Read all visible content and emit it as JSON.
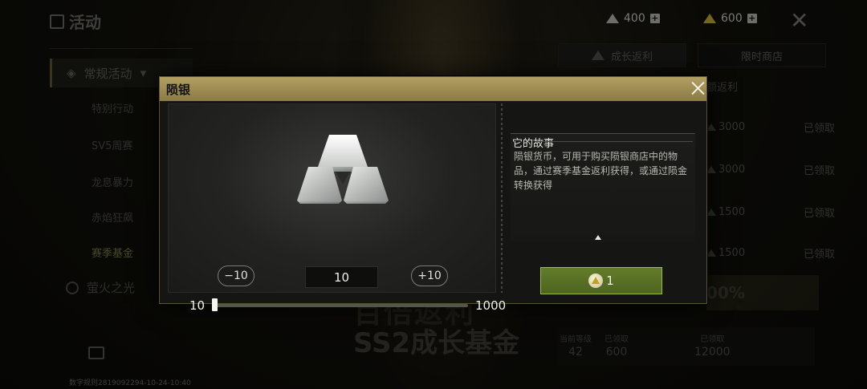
{
  "background": {
    "title": "活动",
    "resources": [
      {
        "icon": "silver-ingot-icon",
        "value": "400"
      },
      {
        "icon": "gold-ingot-icon",
        "value": "600"
      }
    ],
    "sidebar": {
      "section": "常规活动",
      "items": [
        "特别行动",
        "SV5周赛",
        "龙息暴力",
        "赤焰狂飙",
        "赛季基金"
      ],
      "active_index": 4,
      "footer": "萤火之光"
    },
    "tabs": [
      "成长返利",
      "限时商店"
    ],
    "rewards_header": "额返利",
    "rewards": [
      {
        "amount": "3000",
        "status": "已领取"
      },
      {
        "amount": "3000",
        "status": "已领取"
      },
      {
        "amount": "1500",
        "status": "已领取"
      },
      {
        "amount": "1500",
        "status": "已领取"
      }
    ],
    "percent": "00%",
    "banner_line1": "百倍返利",
    "banner_line2": "SS2成长基金",
    "stats": [
      {
        "label": "当前等级",
        "value": "42"
      },
      {
        "label": "已领取",
        "value": "600"
      },
      {
        "label": "已领取",
        "value": "12000"
      }
    ],
    "watermark": "数字规则2819092294-10-24-10:40"
  },
  "modal": {
    "title": "陨银",
    "item_icon": "silver-ingot-stack",
    "minus_label": "−10",
    "plus_label": "+10",
    "quantity": "10",
    "slider": {
      "min": "10",
      "max": "1000",
      "value_fraction": 0.0
    },
    "story_heading": "它的故事",
    "story_text": "陨银货币，可用于购买陨银商店中的物品，通过赛季基金返利获得，或通过陨金转换获得",
    "buy_cost": "1",
    "colors": {
      "accent_bar": "#b39f62",
      "buy_button": "#5a7225"
    }
  }
}
